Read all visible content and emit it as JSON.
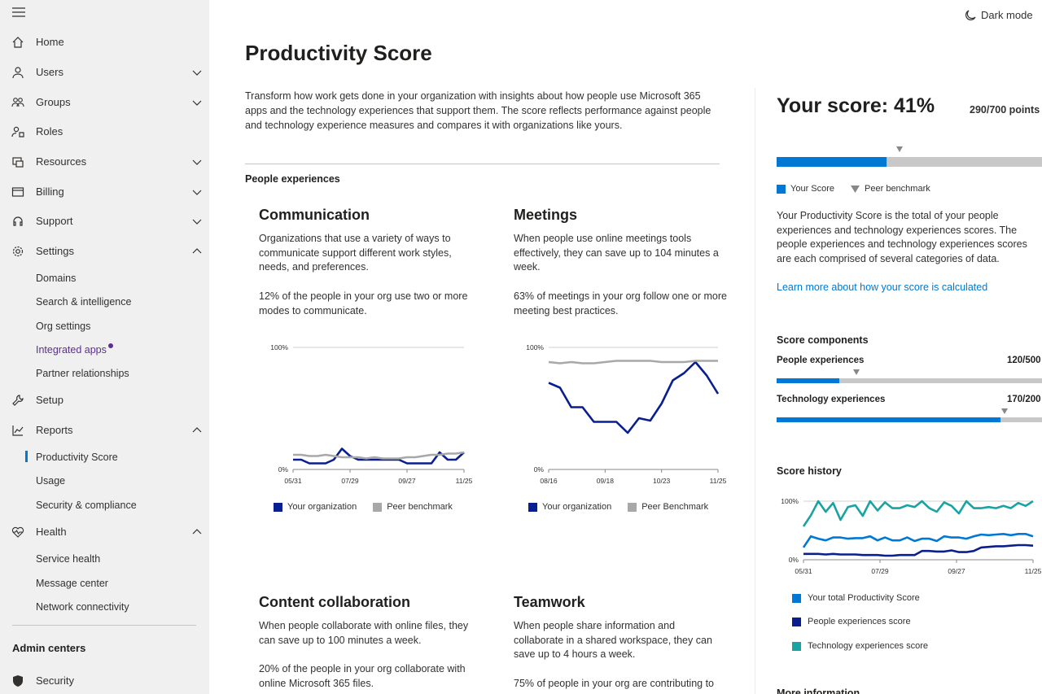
{
  "sidebar": {
    "items": [
      {
        "label": "Home",
        "icon": "home-icon",
        "chevron": ""
      },
      {
        "label": "Users",
        "icon": "user-icon",
        "chevron": "down"
      },
      {
        "label": "Groups",
        "icon": "groups-icon",
        "chevron": "down"
      },
      {
        "label": "Roles",
        "icon": "roles-icon",
        "chevron": ""
      },
      {
        "label": "Resources",
        "icon": "resources-icon",
        "chevron": "down"
      },
      {
        "label": "Billing",
        "icon": "billing-icon",
        "chevron": "down"
      },
      {
        "label": "Support",
        "icon": "headset-icon",
        "chevron": "down"
      },
      {
        "label": "Settings",
        "icon": "gear-icon",
        "chevron": "up"
      }
    ],
    "settings_sub": [
      "Domains",
      "Search & intelligence",
      "Org settings",
      "Integrated apps",
      "Partner relationships"
    ],
    "items2": [
      {
        "label": "Setup",
        "icon": "wrench-icon",
        "chevron": ""
      },
      {
        "label": "Reports",
        "icon": "chart-icon",
        "chevron": "up"
      }
    ],
    "reports_sub": [
      "Productivity Score",
      "Usage",
      "Security & compliance"
    ],
    "health": {
      "label": "Health",
      "icon": "heart-icon",
      "chevron": "up"
    },
    "health_sub": [
      "Service health",
      "Message center",
      "Network connectivity"
    ],
    "admin_centers": "Admin centers",
    "security": {
      "label": "Security",
      "icon": "shield-icon"
    }
  },
  "header": {
    "dark_mode": "Dark mode"
  },
  "main": {
    "title": "Productivity Score",
    "intro": "Transform how work gets done in your organization with insights about how people use Microsoft 365 apps and the technology experiences that support them. The score reflects performance against people and technology experience measures and compares it with organizations like yours.",
    "section": "People experiences",
    "cards": [
      {
        "title": "Communication",
        "desc": "Organizations that use a variety of ways to communicate support different work styles, needs, and preferences.",
        "stat": "12% of the people in your org use two or more modes to communicate.",
        "legend_org": "Your organization",
        "legend_peer": "Peer benchmark"
      },
      {
        "title": "Meetings",
        "desc": "When people use online meetings tools effectively, they can save up to 104 minutes a week.",
        "stat": "63% of meetings in your org follow one or more meeting best practices.",
        "legend_org": "Your organization",
        "legend_peer": "Peer Benchmark"
      },
      {
        "title": "Content collaboration",
        "desc": "When people collaborate with online files, they can save up to 100 minutes a week.",
        "stat": "20% of the people in your org collaborate with online Microsoft 365 files."
      },
      {
        "title": "Teamwork",
        "desc": "When people share information and collaborate in a shared workspace, they can save up to 4 hours a week.",
        "stat": "75% of people in your org are contributing to"
      }
    ]
  },
  "right": {
    "score_title": "Your score: 41%",
    "points": "290/700 points",
    "legend_score": "Your Score",
    "legend_peer": "Peer benchmark",
    "desc": "Your Productivity Score is the total of your people experiences and technology experiences scores. The people experiences and technology experiences scores are each comprised of several categories of data.",
    "link": "Learn more about how your score is calculated",
    "components_hdr": "Score components",
    "people_label": "People experiences",
    "people_val": "120/500",
    "tech_label": "Technology experiences",
    "tech_val": "170/200",
    "history_hdr": "Score history",
    "hist_legend": [
      "Your total Productivity Score",
      "People experiences score",
      "Technology experiences score"
    ],
    "more_info": "More information"
  },
  "colors": {
    "accent": "#0078d4",
    "navy": "#0a1f8f",
    "teal": "#1aa3a3",
    "grey": "#a8a8a8",
    "purple": "#5c2e91"
  },
  "chart_data": [
    {
      "type": "line",
      "name": "Communication",
      "y_ticks": [
        "100%",
        "0%"
      ],
      "x_ticks": [
        "05/31",
        "07/29",
        "09/27",
        "11/25"
      ],
      "ylim": [
        0,
        100
      ],
      "series": [
        {
          "name": "Your organization",
          "values": [
            8,
            8,
            5,
            5,
            5,
            8,
            17,
            11,
            8,
            8,
            8,
            8,
            8,
            8,
            5,
            5,
            5,
            5,
            14,
            8,
            8,
            14
          ]
        },
        {
          "name": "Peer benchmark",
          "values": [
            12,
            12,
            11,
            11,
            12,
            11,
            10,
            10,
            10,
            9,
            10,
            9,
            9,
            9,
            10,
            10,
            11,
            12,
            12,
            13,
            13,
            14
          ]
        }
      ]
    },
    {
      "type": "line",
      "name": "Meetings",
      "y_ticks": [
        "100%",
        "0%"
      ],
      "x_ticks": [
        "08/16",
        "09/18",
        "10/23",
        "11/25"
      ],
      "ylim": [
        0,
        100
      ],
      "series": [
        {
          "name": "Your organization",
          "values": [
            71,
            67,
            51,
            51,
            39,
            39,
            39,
            30,
            42,
            40,
            54,
            73,
            79,
            88,
            77,
            62
          ]
        },
        {
          "name": "Peer Benchmark",
          "values": [
            88,
            87,
            88,
            87,
            87,
            88,
            89,
            89,
            89,
            89,
            88,
            88,
            88,
            89,
            89,
            89
          ]
        }
      ]
    },
    {
      "type": "line",
      "name": "Score history",
      "y_ticks": [
        "100%",
        "0%"
      ],
      "x_ticks": [
        "05/31",
        "07/29",
        "09/27",
        "11/25"
      ],
      "ylim": [
        0,
        100
      ],
      "series": [
        {
          "name": "Technology experiences score",
          "values": [
            57,
            76,
            100,
            82,
            97,
            68,
            90,
            93,
            75,
            100,
            84,
            98,
            88,
            88,
            93,
            90,
            100,
            88,
            82,
            98,
            92,
            79,
            100,
            88,
            88,
            90,
            88,
            92,
            88,
            97,
            92,
            100
          ]
        },
        {
          "name": "Your total Productivity Score",
          "values": [
            21,
            40,
            36,
            33,
            38,
            38,
            36,
            37,
            37,
            40,
            33,
            38,
            33,
            33,
            38,
            32,
            36,
            36,
            32,
            40,
            38,
            38,
            36,
            40,
            43,
            42,
            43,
            44,
            42,
            44,
            44,
            40
          ]
        },
        {
          "name": "People experiences score",
          "values": [
            10,
            10,
            10,
            9,
            10,
            9,
            9,
            9,
            8,
            8,
            8,
            7,
            7,
            8,
            8,
            8,
            15,
            15,
            14,
            14,
            16,
            13,
            13,
            15,
            21,
            22,
            23,
            23,
            24,
            25,
            25,
            24
          ]
        }
      ]
    }
  ]
}
